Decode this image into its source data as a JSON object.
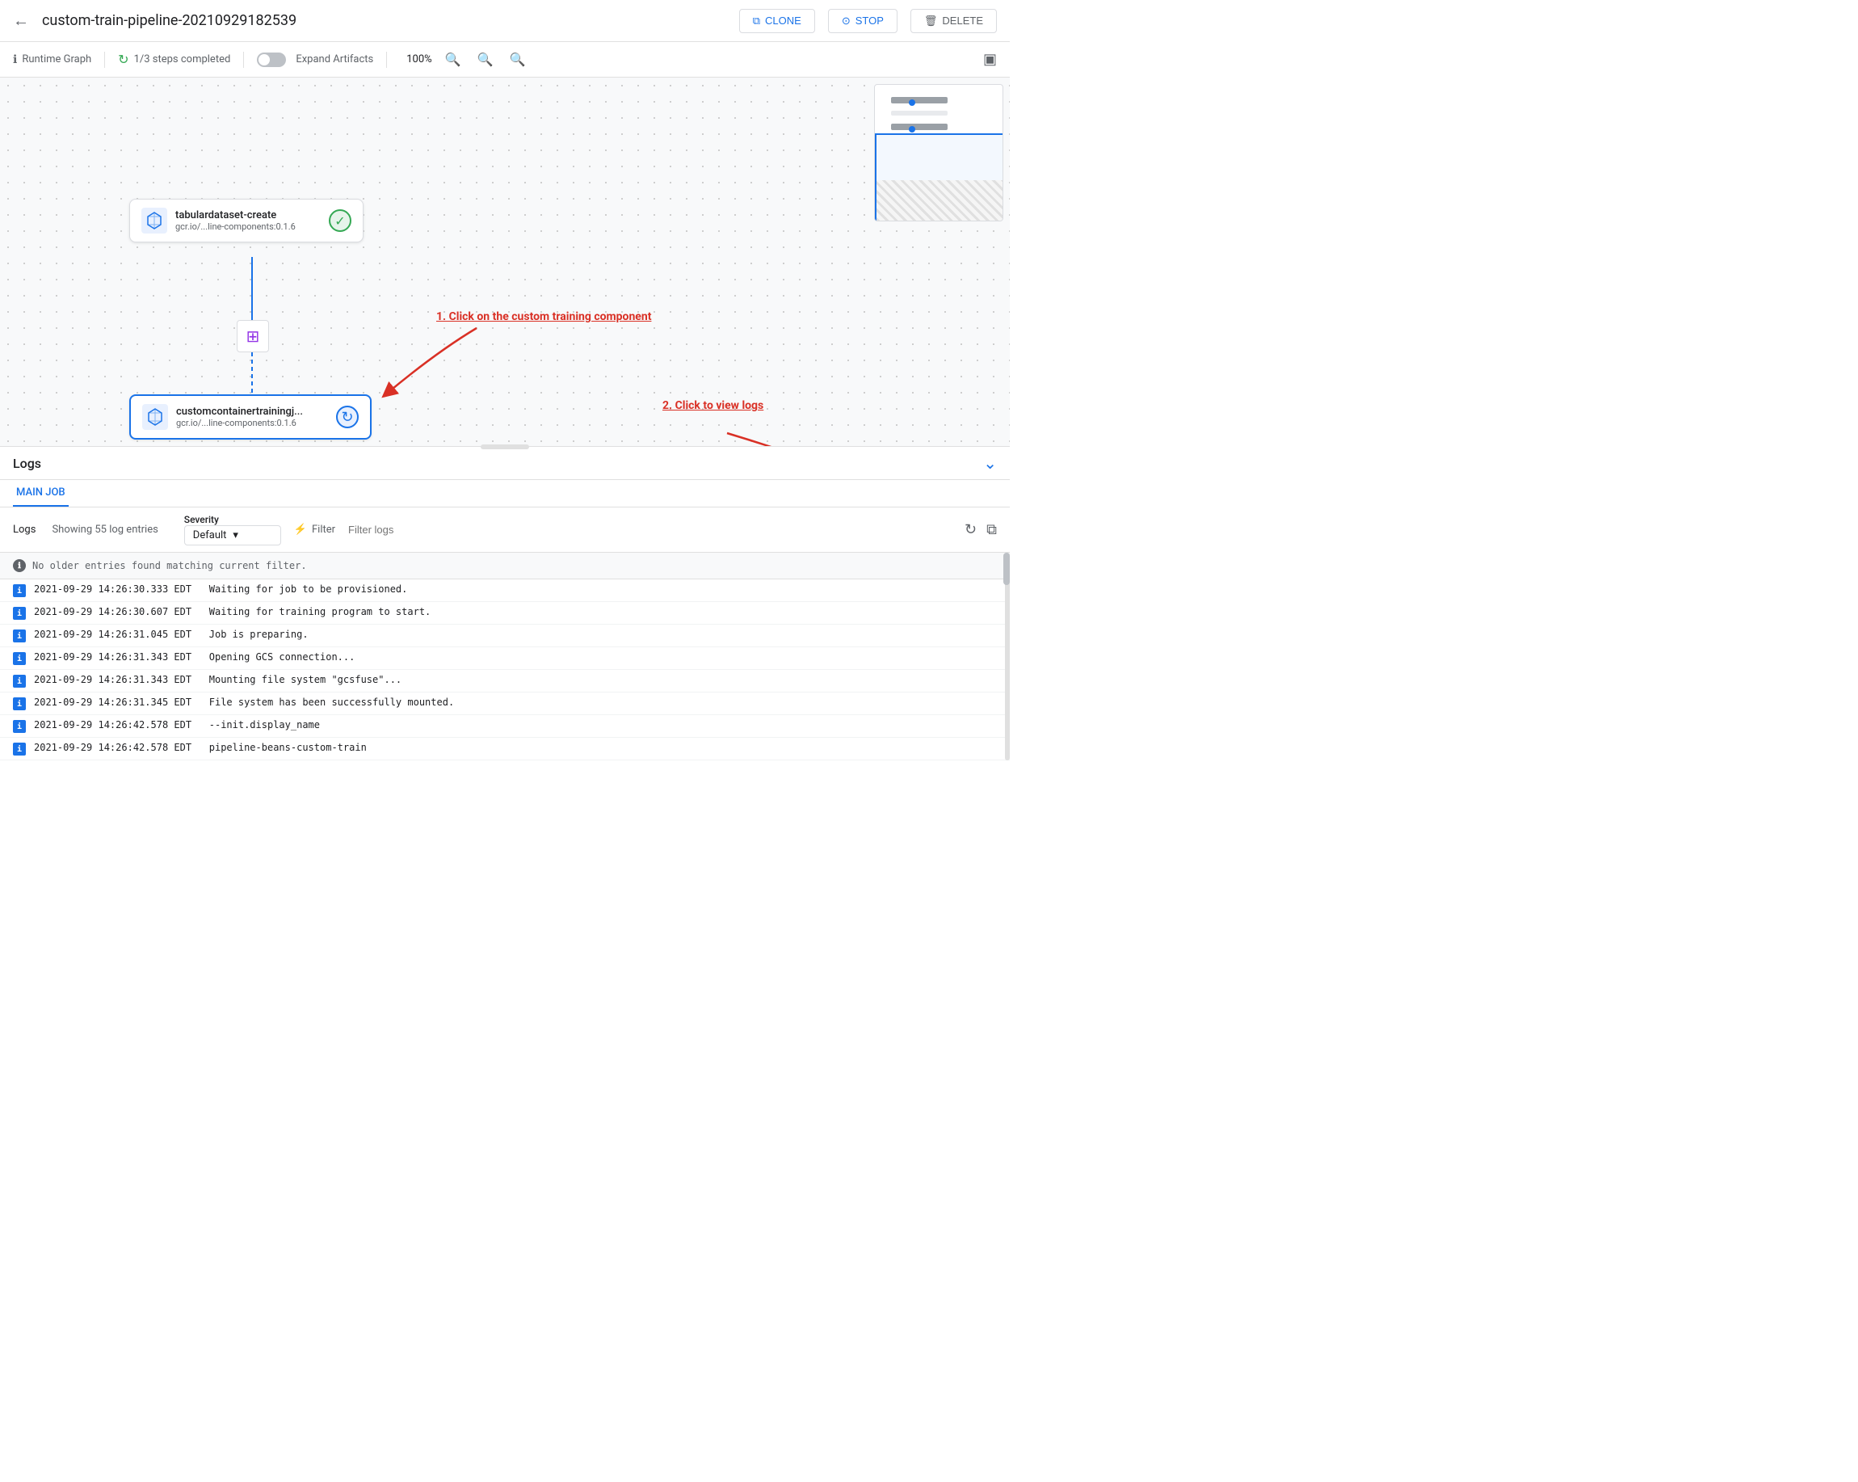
{
  "header": {
    "back_icon": "←",
    "title": "custom-train-pipeline-20210929182539",
    "clone_label": "CLONE",
    "stop_label": "STOP",
    "delete_label": "DELETE"
  },
  "toolbar": {
    "runtime_graph_label": "Runtime Graph",
    "steps_completed_label": "1/3 steps completed",
    "expand_artifacts_label": "Expand Artifacts",
    "zoom_level": "100%",
    "zoom_in": "+",
    "zoom_out": "−",
    "zoom_reset": "⊙"
  },
  "pipeline": {
    "nodes": [
      {
        "id": "node1",
        "name": "tabulardataset-create",
        "sub": "gcr.io/...line-components:0.1.6",
        "status": "success",
        "status_icon": "✓"
      },
      {
        "id": "node2",
        "name": "customcontainertrainingj...",
        "sub": "gcr.io/...line-components:0.1.6",
        "status": "running",
        "status_icon": "↻"
      }
    ],
    "annotation1_text": "1. Click on the custom training component",
    "annotation2_text": "2. Click to view logs"
  },
  "logs": {
    "title": "Logs",
    "collapse_icon": "⌄",
    "tabs": [
      {
        "label": "MAIN JOB",
        "active": true
      }
    ],
    "logs_label": "Logs",
    "showing_text": "Showing 55 log entries",
    "severity_label": "Severity",
    "severity_default": "Default",
    "filter_label": "Filter",
    "filter_placeholder": "Filter logs",
    "no_older_text": "No older entries found matching current filter.",
    "entries": [
      {
        "timestamp": "2021-09-29 14:26:30.333 EDT",
        "message": "Waiting for job to be provisioned."
      },
      {
        "timestamp": "2021-09-29 14:26:30.607 EDT",
        "message": "Waiting for training program to start."
      },
      {
        "timestamp": "2021-09-29 14:26:31.045 EDT",
        "message": "Job is preparing."
      },
      {
        "timestamp": "2021-09-29 14:26:31.343 EDT",
        "message": "Opening GCS connection..."
      },
      {
        "timestamp": "2021-09-29 14:26:31.343 EDT",
        "message": "Mounting file system \"gcsfuse\"..."
      },
      {
        "timestamp": "2021-09-29 14:26:31.345 EDT",
        "message": "File system has been successfully mounted."
      },
      {
        "timestamp": "2021-09-29 14:26:42.578 EDT",
        "message": "--init.display_name"
      },
      {
        "timestamp": "2021-09-29 14:26:42.578 EDT",
        "message": "pipeline-beans-custom-train"
      }
    ]
  }
}
